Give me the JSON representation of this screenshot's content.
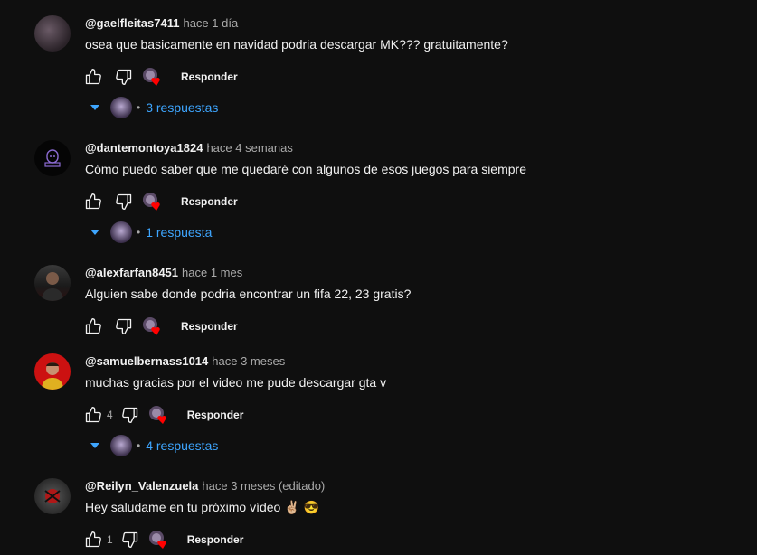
{
  "comments": [
    {
      "author": "@gaelfleitas7411",
      "time": "hace 1 día",
      "text": "osea que basicamente en navidad podria descargar MK??? gratuitamente?",
      "likes": "",
      "reply_label": "Responder",
      "replies_label": "3 respuestas"
    },
    {
      "author": "@dantemontoya1824",
      "time": "hace 4 semanas",
      "text": "Cómo puedo saber que me quedaré con algunos de esos juegos para siempre",
      "likes": "",
      "reply_label": "Responder",
      "replies_label": "1 respuesta"
    },
    {
      "author": "@alexfarfan8451",
      "time": "hace 1 mes",
      "text": "Alguien sabe donde podria encontrar un fifa 22, 23 gratis?",
      "likes": "",
      "reply_label": "Responder"
    },
    {
      "author": "@samuelbernass1014",
      "time": "hace 3 meses",
      "text": "muchas gracias por el video me pude descargar gta v",
      "likes": "4",
      "reply_label": "Responder",
      "replies_label": "4 respuestas"
    },
    {
      "author": "@Reilyn_Valenzuela",
      "time": "hace 3 meses (editado)",
      "text": "Hey saludame en tu próximo vídeo ✌🏼 😎",
      "likes": "1",
      "reply_label": "Responder"
    }
  ],
  "colors": {
    "background": "#0f0f0f",
    "text": "#f1f1f1",
    "secondary": "#aaaaaa",
    "link": "#3ea6ff",
    "heart": "#ff0000"
  },
  "icons": [
    "like-icon",
    "dislike-icon",
    "creator-heart-icon",
    "caret-down-icon"
  ]
}
